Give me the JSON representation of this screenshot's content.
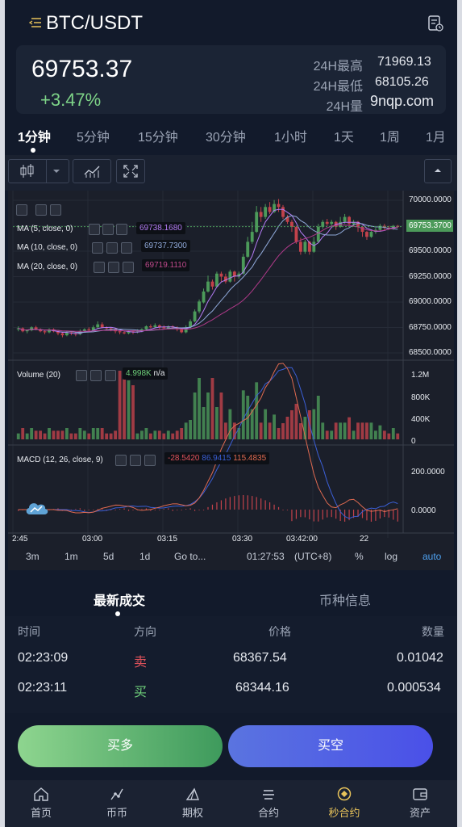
{
  "header": {
    "pair": "BTC/USDT"
  },
  "ticker": {
    "last": "69753.37",
    "change": "+3.47%",
    "stats": [
      {
        "label": "24H最高",
        "value": "71969.13"
      },
      {
        "label": "24H最低",
        "value": "68105.26"
      },
      {
        "label": "24H量",
        "value": "9nqp.com"
      }
    ]
  },
  "intervals": [
    "1分钟",
    "5分钟",
    "15分钟",
    "30分钟",
    "1小时",
    "1天",
    "1周",
    "1月"
  ],
  "active_interval": "1分钟",
  "chart": {
    "price_axis": [
      "70000.0000",
      "69750.0000",
      "69500.0000",
      "69250.0000",
      "69000.0000",
      "68750.0000",
      "68500.0000"
    ],
    "last_price_tag": "69753.3700",
    "legends": {
      "ma5": {
        "label": "MA (5, close, 0)",
        "value": "69738.1680",
        "color": "#b47cf5"
      },
      "ma10": {
        "label": "MA (10, close, 0)",
        "value": "69737.7300",
        "color": "#8fa8d8"
      },
      "ma20": {
        "label": "MA (20, close, 0)",
        "value": "69719.1110",
        "color": "#b03a8a"
      },
      "volume": {
        "label": "Volume (20)",
        "value": "4.998K",
        "extra": "n/a"
      },
      "macd": {
        "label": "MACD (12, 26, close, 9)",
        "v1": "-28.5420",
        "v2": "86.9415",
        "v3": "115.4835"
      }
    },
    "volume_axis": [
      "1.2M",
      "800K",
      "400K",
      "0"
    ],
    "macd_axis": [
      "200.0000",
      "0.0000"
    ],
    "time_axis": [
      "2:45",
      "03:00",
      "03:15",
      "03:30",
      "03:42:00",
      "22"
    ],
    "ranges": [
      "3m",
      "1m",
      "5d",
      "1d",
      "Go to..."
    ],
    "clock": "01:27:53",
    "tz": "(UTC+8)",
    "options": [
      "%",
      "log",
      "auto"
    ],
    "colors": {
      "up": "#4c9a5a",
      "down": "#c2424b",
      "bg": "#1b1f2a"
    }
  },
  "chart_data": {
    "type": "candlestick",
    "price_range": [
      68450,
      70050
    ],
    "candles": [
      [
        68720,
        68730,
        68700,
        68750
      ],
      [
        68730,
        68700,
        68690,
        68740
      ],
      [
        68700,
        68710,
        68680,
        68720
      ],
      [
        68710,
        68740,
        68700,
        68750
      ],
      [
        68740,
        68720,
        68710,
        68755
      ],
      [
        68720,
        68700,
        68690,
        68730
      ],
      [
        68700,
        68690,
        68670,
        68715
      ],
      [
        68690,
        68720,
        68680,
        68730
      ],
      [
        68720,
        68700,
        68690,
        68730
      ],
      [
        68700,
        68680,
        68660,
        68710
      ],
      [
        68680,
        68660,
        68640,
        68690
      ],
      [
        68660,
        68690,
        68650,
        68700
      ],
      [
        68690,
        68680,
        68660,
        68700
      ],
      [
        68680,
        68670,
        68650,
        68690
      ],
      [
        68670,
        68700,
        68660,
        68720
      ],
      [
        68700,
        68720,
        68690,
        68730
      ],
      [
        68720,
        68710,
        68690,
        68740
      ],
      [
        68710,
        68740,
        68700,
        68760
      ],
      [
        68740,
        68770,
        68730,
        68800
      ],
      [
        68770,
        68740,
        68730,
        68790
      ],
      [
        68740,
        68730,
        68710,
        68750
      ],
      [
        68730,
        68720,
        68700,
        68740
      ],
      [
        68720,
        68700,
        68680,
        68730
      ],
      [
        68700,
        68690,
        68670,
        68710
      ],
      [
        68690,
        68680,
        68670,
        68700
      ],
      [
        68680,
        68700,
        68670,
        68710
      ],
      [
        68700,
        68690,
        68670,
        68710
      ],
      [
        68690,
        68700,
        68680,
        68720
      ],
      [
        68700,
        68720,
        68690,
        68730
      ],
      [
        68720,
        68750,
        68710,
        68760
      ],
      [
        68750,
        68740,
        68730,
        68770
      ],
      [
        68740,
        68760,
        68730,
        68780
      ],
      [
        68760,
        68740,
        68720,
        68770
      ],
      [
        68740,
        68730,
        68720,
        68760
      ],
      [
        68730,
        68750,
        68720,
        68760
      ],
      [
        68750,
        68740,
        68720,
        68760
      ],
      [
        68740,
        68720,
        68700,
        68750
      ],
      [
        68720,
        68690,
        68680,
        68730
      ],
      [
        68690,
        68740,
        68680,
        68760
      ],
      [
        68740,
        68800,
        68730,
        68820
      ],
      [
        68800,
        68900,
        68790,
        68920
      ],
      [
        68900,
        69000,
        68880,
        69020
      ],
      [
        68990,
        69100,
        68980,
        69130
      ],
      [
        69100,
        69200,
        69090,
        69260
      ],
      [
        69200,
        69150,
        69120,
        69220
      ],
      [
        69150,
        69280,
        69140,
        69300
      ],
      [
        69280,
        69250,
        69200,
        69300
      ],
      [
        69250,
        69200,
        69180,
        69280
      ],
      [
        69200,
        69300,
        69190,
        69320
      ],
      [
        69300,
        69250,
        69200,
        69310
      ],
      [
        69250,
        69280,
        69230,
        69300
      ],
      [
        69280,
        69450,
        69270,
        69480
      ],
      [
        69450,
        69600,
        69440,
        69650
      ],
      [
        69600,
        69700,
        69580,
        69800
      ],
      [
        69700,
        69900,
        69690,
        69960
      ],
      [
        69900,
        69850,
        69800,
        69950
      ],
      [
        69850,
        69950,
        69830,
        69980
      ],
      [
        69950,
        69900,
        69880,
        70000
      ],
      [
        69900,
        69980,
        69890,
        70020
      ],
      [
        69980,
        69950,
        69900,
        70030
      ],
      [
        69950,
        69850,
        69830,
        69970
      ],
      [
        69850,
        69800,
        69780,
        69870
      ],
      [
        69800,
        69750,
        69700,
        69820
      ],
      [
        69750,
        69600,
        69580,
        69760
      ],
      [
        69600,
        69500,
        69470,
        69640
      ],
      [
        69500,
        69600,
        69480,
        69620
      ],
      [
        69600,
        69500,
        69470,
        69610
      ],
      [
        69500,
        69600,
        69490,
        69650
      ],
      [
        69600,
        69750,
        69590,
        69780
      ],
      [
        69750,
        69800,
        69730,
        69820
      ],
      [
        69800,
        69780,
        69760,
        69830
      ],
      [
        69780,
        69800,
        69760,
        69820
      ],
      [
        69800,
        69750,
        69720,
        69810
      ],
      [
        69750,
        69800,
        69740,
        69850
      ],
      [
        69800,
        69850,
        69780,
        69880
      ],
      [
        69850,
        69780,
        69760,
        69860
      ],
      [
        69780,
        69800,
        69760,
        69820
      ],
      [
        69800,
        69750,
        69700,
        69810
      ],
      [
        69750,
        69700,
        69650,
        69760
      ],
      [
        69700,
        69650,
        69620,
        69710
      ],
      [
        69650,
        69700,
        69640,
        69720
      ],
      [
        69700,
        69720,
        69680,
        69740
      ],
      [
        69720,
        69760,
        69700,
        69780
      ],
      [
        69760,
        69740,
        69720,
        69780
      ],
      [
        69740,
        69730,
        69720,
        69760
      ],
      [
        69730,
        69760,
        69720,
        69770
      ],
      [
        69760,
        69750,
        69740,
        69770
      ]
    ]
  },
  "trades": {
    "tabs": [
      "最新成交",
      "币种信息"
    ],
    "columns": [
      "时间",
      "方向",
      "价格",
      "数量"
    ],
    "rows": [
      {
        "time": "02:23:09",
        "side": "卖",
        "price": "68367.54",
        "qty": "0.01042",
        "side_color": "#e0525b"
      },
      {
        "time": "02:23:11",
        "side": "买",
        "price": "68344.16",
        "qty": "0.000534",
        "side_color": "#6fd07a"
      }
    ]
  },
  "actions": {
    "buy": "买多",
    "sell": "买空"
  },
  "nav": {
    "items": [
      "首页",
      "币币",
      "期权",
      "合约",
      "秒合约",
      "资产"
    ],
    "active": "秒合约",
    "active_color": "#e8c35a"
  }
}
